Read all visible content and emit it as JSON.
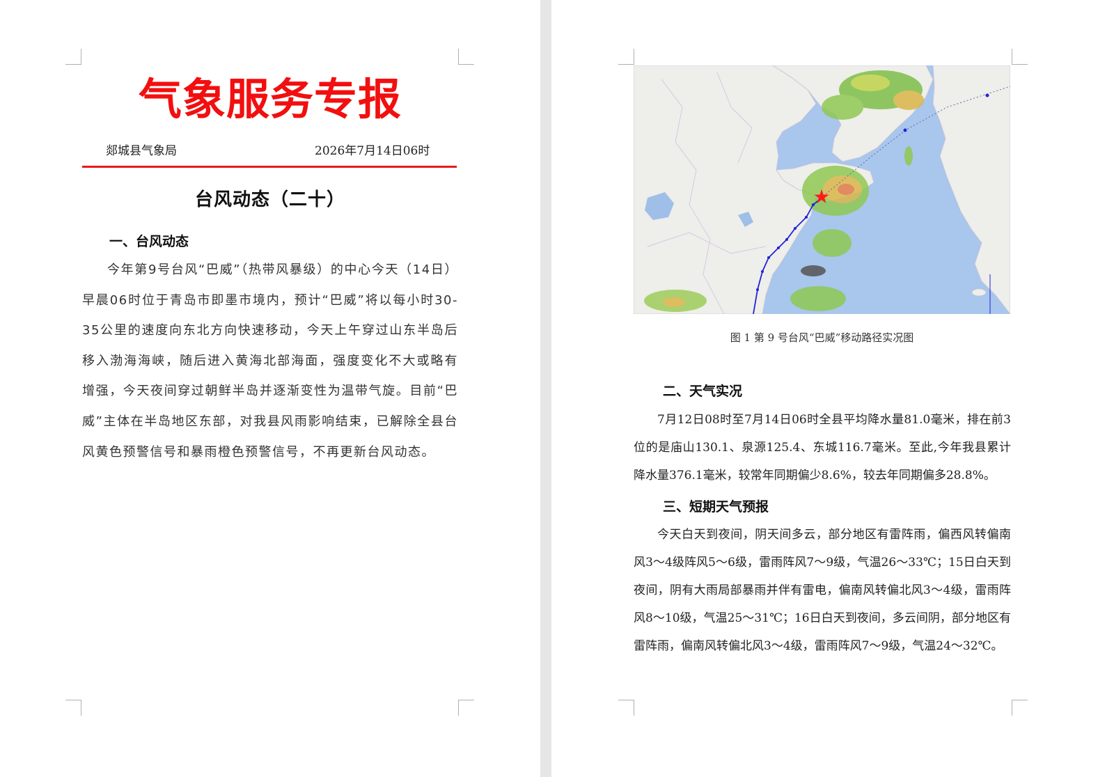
{
  "page1": {
    "masthead": "气象服务专报",
    "issuer": "郯城县气象局",
    "issue_time": "2026年7月14日06时",
    "title": "台风动态（二十）",
    "section1": {
      "heading": "一、台风动态",
      "body": "今年第9号台风“巴威”（热带风暴级）的中心今天（14日）早晨06时位于青岛市即墨市境内，预计“巴威”将以每小时30-35公里的速度向东北方向快速移动，今天上午穿过山东半岛后移入渤海海峡，随后进入黄海北部海面，强度变化不大或略有增强，今天夜间穿过朝鲜半岛并逐渐变性为温带气旋。目前“巴威”主体在半岛地区东部，对我县风雨影响结束，已解除全县台风黄色预警信号和暴雨橙色预警信号，不再更新台风动态。"
    }
  },
  "page2": {
    "figure_caption": "图 1 第 9 号台风“巴威”移动路径实况图",
    "section2": {
      "heading": "二、天气实况",
      "body": "7月12日08时至7月14日06时全县平均降水量81.0毫米，排在前3位的是庙山130.1、泉源125.4、东城116.7毫米。至此,今年我县累计降水量376.1毫米，较常年同期偏少8.6%，较去年同期偏多28.8%。"
    },
    "section3": {
      "heading": "三、短期天气预报",
      "body": "今天白天到夜间，阴天间多云，部分地区有雷阵雨，偏西风转偏南风3～4级阵风5～6级，雷雨阵风7～9级，气温26～33℃；15日白天到夜间，阴有大雨局部暴雨并伴有雷电，偏南风转偏北风3～4级，雷雨阵风8～10级，气温25～31℃；16日白天到夜间，多云间阴，部分地区有雷阵雨，偏南风转偏北风3～4级，雷雨阵风7～9级，气温24～32℃。"
    }
  },
  "colors": {
    "masthead_red": "#f20f0f",
    "rule_red": "#e51c1c",
    "sea": "#a9c6ec",
    "land": "#eeeeea",
    "track": "#2222dd",
    "current_position": "#ff1a1a"
  }
}
